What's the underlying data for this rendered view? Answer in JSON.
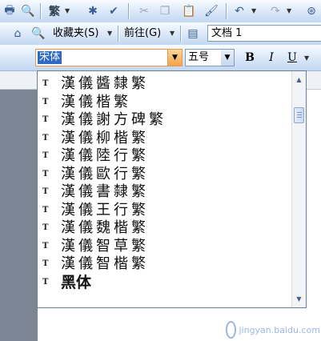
{
  "toolbar1": {
    "icons": [
      "print-icon",
      "print-preview-icon",
      "traditional-chinese-icon",
      "research-icon",
      "spellcheck-icon",
      "cut-icon",
      "copy-icon",
      "paste-icon",
      "format-painter-icon",
      "undo-icon",
      "redo-icon",
      "hyperlink-icon"
    ],
    "traditional_label": "繁"
  },
  "toolbar2": {
    "favorites_label": "收藏夹(S)",
    "goto_label": "前往(G)",
    "document_title": "文档 1"
  },
  "format": {
    "font_value": "宋体",
    "size_value": "五号",
    "bold": "B",
    "italic": "I",
    "underline": "U"
  },
  "font_list": {
    "items": [
      "漢儀醬隸繁",
      "漢儀楷繁",
      "漢儀謝方碑繁",
      "漢儀柳楷繁",
      "漢儀陸行繁",
      "漢儀歐行繁",
      "漢儀書隸繁",
      "漢儀王行繁",
      "漢儀魏楷繁",
      "漢儀智草繁",
      "漢儀智楷繁",
      "黑体"
    ],
    "type_glyph": "T"
  },
  "watermark": {
    "text": "jingyan.baidu.com"
  }
}
